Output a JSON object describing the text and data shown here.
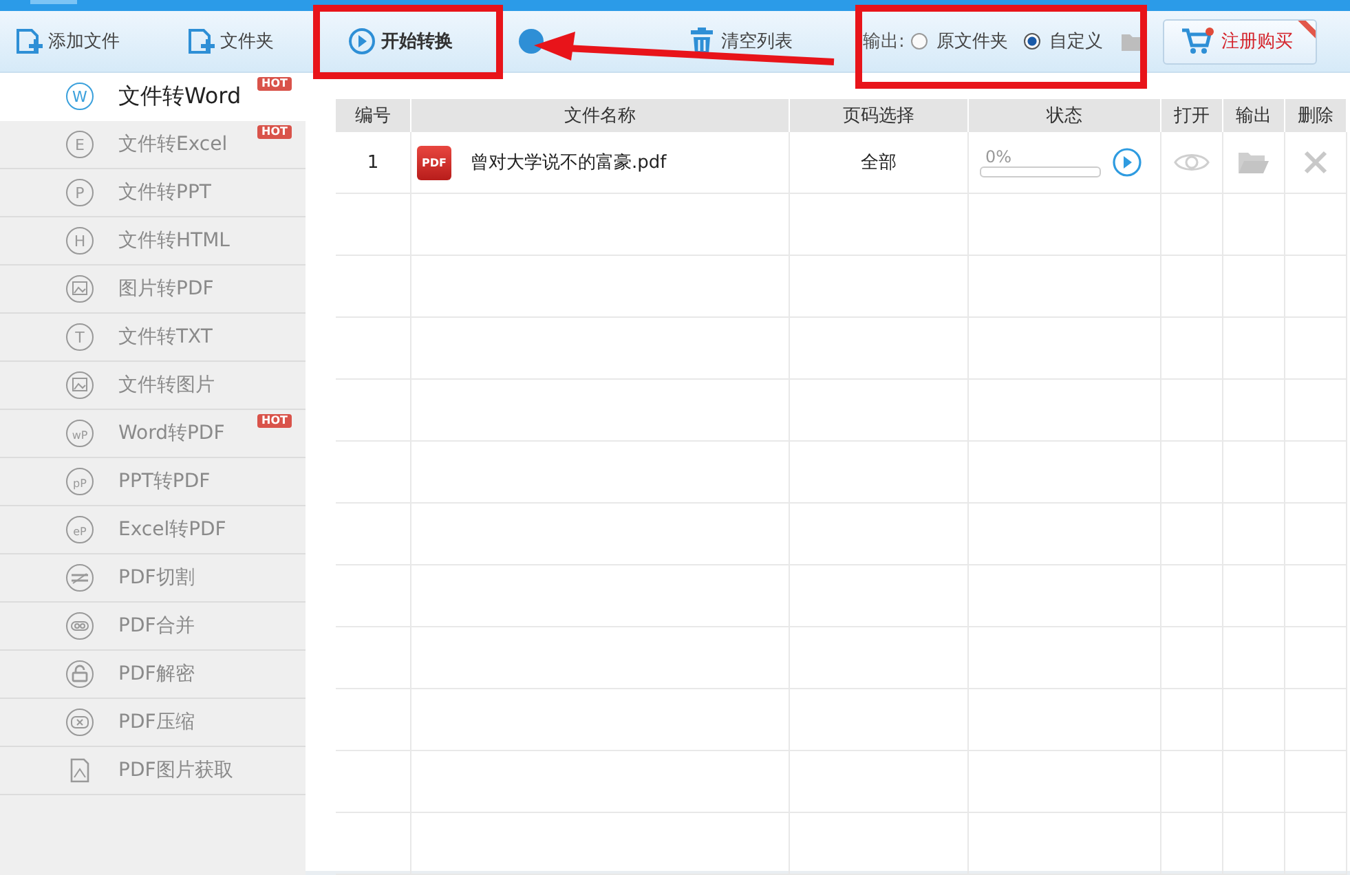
{
  "toolbar": {
    "buttons": [
      {
        "kind": "add-file",
        "label": "添加文件"
      },
      {
        "kind": "add-folder",
        "label": "文件夹"
      },
      {
        "kind": "start",
        "label": "开始转换"
      },
      {
        "kind": "stop"
      },
      {
        "kind": "clear",
        "label": "清空列表"
      }
    ],
    "output": {
      "label": "输出:",
      "options": [
        {
          "label": "原文件夹",
          "selected": false
        },
        {
          "label": "自定义",
          "selected": true
        }
      ]
    },
    "buy_button": {
      "label": "注册购买"
    }
  },
  "sidebar": {
    "items": [
      {
        "label": "文件转Word",
        "kind": "letter",
        "icon_text": "W",
        "badge": "HOT",
        "selected": true
      },
      {
        "label": "文件转Excel",
        "kind": "letter",
        "icon_text": "E",
        "badge": "HOT",
        "selected": false
      },
      {
        "label": "文件转PPT",
        "kind": "letter",
        "icon_text": "P",
        "selected": false
      },
      {
        "label": "文件转HTML",
        "kind": "letter",
        "icon_text": "H",
        "selected": false
      },
      {
        "label": "图片转PDF",
        "kind": "image",
        "selected": false
      },
      {
        "label": "文件转TXT",
        "kind": "letter",
        "icon_text": "T",
        "selected": false
      },
      {
        "label": "文件转图片",
        "kind": "image",
        "selected": false
      },
      {
        "label": "Word转PDF",
        "kind": "letter",
        "icon_text": "wP",
        "badge": "HOT",
        "selected": false
      },
      {
        "label": "PPT转PDF",
        "kind": "letter",
        "icon_text": "pP",
        "selected": false
      },
      {
        "label": "Excel转PDF",
        "kind": "letter",
        "icon_text": "eP",
        "selected": false
      },
      {
        "label": "PDF切割",
        "kind": "cut",
        "selected": false
      },
      {
        "label": "PDF合并",
        "kind": "merge",
        "selected": false
      },
      {
        "label": "PDF解密",
        "kind": "lock",
        "selected": false
      },
      {
        "label": "PDF压缩",
        "kind": "compress",
        "selected": false
      },
      {
        "label": "PDF图片获取",
        "kind": "file",
        "selected": false
      }
    ]
  },
  "table": {
    "columns": [
      "编号",
      "文件名称",
      "页码选择",
      "状态",
      "打开",
      "输出",
      "删除"
    ],
    "rows": [
      {
        "number": "1",
        "file_icon": "PDF",
        "file_name": "曾对大学说不的富豪.pdf",
        "pages": "全部",
        "status": {
          "reading": "0%",
          "level": 0
        }
      }
    ]
  },
  "annotations": [
    {
      "kind": "box"
    },
    {
      "kind": "box"
    },
    {
      "kind": "arrow"
    }
  ]
}
